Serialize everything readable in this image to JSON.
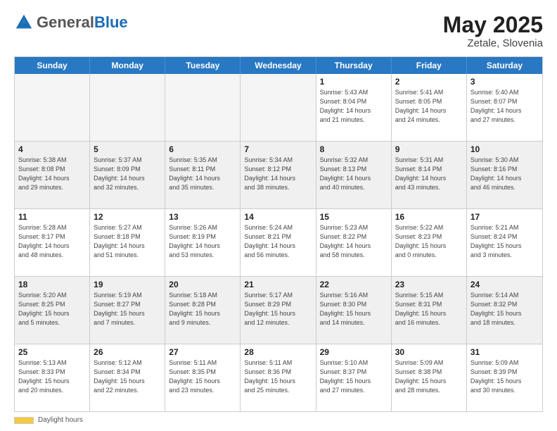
{
  "header": {
    "logo_general": "General",
    "logo_blue": "Blue",
    "month_year": "May 2025",
    "location": "Zetale, Slovenia"
  },
  "weekdays": [
    "Sunday",
    "Monday",
    "Tuesday",
    "Wednesday",
    "Thursday",
    "Friday",
    "Saturday"
  ],
  "footer": {
    "daylight_label": "Daylight hours"
  },
  "weeks": [
    [
      {
        "day": "",
        "info": "",
        "empty": true
      },
      {
        "day": "",
        "info": "",
        "empty": true
      },
      {
        "day": "",
        "info": "",
        "empty": true
      },
      {
        "day": "",
        "info": "",
        "empty": true
      },
      {
        "day": "1",
        "info": "Sunrise: 5:43 AM\nSunset: 8:04 PM\nDaylight: 14 hours\nand 21 minutes."
      },
      {
        "day": "2",
        "info": "Sunrise: 5:41 AM\nSunset: 8:05 PM\nDaylight: 14 hours\nand 24 minutes."
      },
      {
        "day": "3",
        "info": "Sunrise: 5:40 AM\nSunset: 8:07 PM\nDaylight: 14 hours\nand 27 minutes."
      }
    ],
    [
      {
        "day": "4",
        "info": "Sunrise: 5:38 AM\nSunset: 8:08 PM\nDaylight: 14 hours\nand 29 minutes."
      },
      {
        "day": "5",
        "info": "Sunrise: 5:37 AM\nSunset: 8:09 PM\nDaylight: 14 hours\nand 32 minutes."
      },
      {
        "day": "6",
        "info": "Sunrise: 5:35 AM\nSunset: 8:11 PM\nDaylight: 14 hours\nand 35 minutes."
      },
      {
        "day": "7",
        "info": "Sunrise: 5:34 AM\nSunset: 8:12 PM\nDaylight: 14 hours\nand 38 minutes."
      },
      {
        "day": "8",
        "info": "Sunrise: 5:32 AM\nSunset: 8:13 PM\nDaylight: 14 hours\nand 40 minutes."
      },
      {
        "day": "9",
        "info": "Sunrise: 5:31 AM\nSunset: 8:14 PM\nDaylight: 14 hours\nand 43 minutes."
      },
      {
        "day": "10",
        "info": "Sunrise: 5:30 AM\nSunset: 8:16 PM\nDaylight: 14 hours\nand 46 minutes."
      }
    ],
    [
      {
        "day": "11",
        "info": "Sunrise: 5:28 AM\nSunset: 8:17 PM\nDaylight: 14 hours\nand 48 minutes."
      },
      {
        "day": "12",
        "info": "Sunrise: 5:27 AM\nSunset: 8:18 PM\nDaylight: 14 hours\nand 51 minutes."
      },
      {
        "day": "13",
        "info": "Sunrise: 5:26 AM\nSunset: 8:19 PM\nDaylight: 14 hours\nand 53 minutes."
      },
      {
        "day": "14",
        "info": "Sunrise: 5:24 AM\nSunset: 8:21 PM\nDaylight: 14 hours\nand 56 minutes."
      },
      {
        "day": "15",
        "info": "Sunrise: 5:23 AM\nSunset: 8:22 PM\nDaylight: 14 hours\nand 58 minutes."
      },
      {
        "day": "16",
        "info": "Sunrise: 5:22 AM\nSunset: 8:23 PM\nDaylight: 15 hours\nand 0 minutes."
      },
      {
        "day": "17",
        "info": "Sunrise: 5:21 AM\nSunset: 8:24 PM\nDaylight: 15 hours\nand 3 minutes."
      }
    ],
    [
      {
        "day": "18",
        "info": "Sunrise: 5:20 AM\nSunset: 8:25 PM\nDaylight: 15 hours\nand 5 minutes."
      },
      {
        "day": "19",
        "info": "Sunrise: 5:19 AM\nSunset: 8:27 PM\nDaylight: 15 hours\nand 7 minutes."
      },
      {
        "day": "20",
        "info": "Sunrise: 5:18 AM\nSunset: 8:28 PM\nDaylight: 15 hours\nand 9 minutes."
      },
      {
        "day": "21",
        "info": "Sunrise: 5:17 AM\nSunset: 8:29 PM\nDaylight: 15 hours\nand 12 minutes."
      },
      {
        "day": "22",
        "info": "Sunrise: 5:16 AM\nSunset: 8:30 PM\nDaylight: 15 hours\nand 14 minutes."
      },
      {
        "day": "23",
        "info": "Sunrise: 5:15 AM\nSunset: 8:31 PM\nDaylight: 15 hours\nand 16 minutes."
      },
      {
        "day": "24",
        "info": "Sunrise: 5:14 AM\nSunset: 8:32 PM\nDaylight: 15 hours\nand 18 minutes."
      }
    ],
    [
      {
        "day": "25",
        "info": "Sunrise: 5:13 AM\nSunset: 8:33 PM\nDaylight: 15 hours\nand 20 minutes."
      },
      {
        "day": "26",
        "info": "Sunrise: 5:12 AM\nSunset: 8:34 PM\nDaylight: 15 hours\nand 22 minutes."
      },
      {
        "day": "27",
        "info": "Sunrise: 5:11 AM\nSunset: 8:35 PM\nDaylight: 15 hours\nand 23 minutes."
      },
      {
        "day": "28",
        "info": "Sunrise: 5:11 AM\nSunset: 8:36 PM\nDaylight: 15 hours\nand 25 minutes."
      },
      {
        "day": "29",
        "info": "Sunrise: 5:10 AM\nSunset: 8:37 PM\nDaylight: 15 hours\nand 27 minutes."
      },
      {
        "day": "30",
        "info": "Sunrise: 5:09 AM\nSunset: 8:38 PM\nDaylight: 15 hours\nand 28 minutes."
      },
      {
        "day": "31",
        "info": "Sunrise: 5:09 AM\nSunset: 8:39 PM\nDaylight: 15 hours\nand 30 minutes."
      }
    ]
  ]
}
